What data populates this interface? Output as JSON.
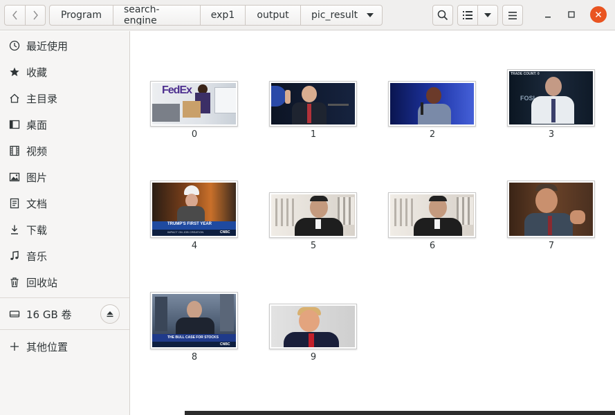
{
  "window": {
    "path": [
      "Program",
      "search-engine",
      "exp1",
      "output",
      "pic_result"
    ]
  },
  "sidebar": {
    "items": [
      {
        "label": "最近使用",
        "icon": "clock-icon"
      },
      {
        "label": "收藏",
        "icon": "star-icon"
      },
      {
        "label": "主目录",
        "icon": "home-icon"
      },
      {
        "label": "桌面",
        "icon": "desktop-icon"
      },
      {
        "label": "视频",
        "icon": "film-icon"
      },
      {
        "label": "图片",
        "icon": "picture-icon"
      },
      {
        "label": "文档",
        "icon": "document-icon"
      },
      {
        "label": "下载",
        "icon": "download-icon"
      },
      {
        "label": "音乐",
        "icon": "music-icon"
      },
      {
        "label": "回收站",
        "icon": "trash-icon"
      }
    ],
    "volume": {
      "label": "16 GB 卷",
      "icon": "drive-icon"
    },
    "other": {
      "label": "其他位置",
      "icon": "plus-icon"
    }
  },
  "files": [
    {
      "name": "0",
      "colors": [
        "#e9ecef",
        "#4d2f8f",
        "#c86b2a"
      ]
    },
    {
      "name": "1",
      "colors": [
        "#0f1a2b",
        "#1e3a7a",
        "#e2b89a"
      ]
    },
    {
      "name": "2",
      "colors": [
        "#0a1a5e",
        "#2a3fb0",
        "#6b3a2a"
      ]
    },
    {
      "name": "3",
      "colors": [
        "#0d1b2a",
        "#27364a",
        "#c49a85"
      ]
    },
    {
      "name": "4",
      "colors": [
        "#3a2a1a",
        "#c56a2a",
        "#1f4aa0"
      ]
    },
    {
      "name": "5",
      "colors": [
        "#e6e2dc",
        "#8a8a8a",
        "#1e1e1e"
      ]
    },
    {
      "name": "6",
      "colors": [
        "#e6e2dc",
        "#8a8a8a",
        "#1e1e1e"
      ]
    },
    {
      "name": "7",
      "colors": [
        "#5a3a26",
        "#b07a55",
        "#3a4a5a"
      ]
    },
    {
      "name": "8",
      "colors": [
        "#5a6a80",
        "#2a3040",
        "#1f3a8a"
      ]
    },
    {
      "name": "9",
      "colors": [
        "#d9d9d9",
        "#1a1f3a",
        "#c8a070"
      ]
    }
  ],
  "thumbnail_text": {
    "0": "FedEx",
    "3": "TRADE COUNT: 0",
    "3b": "FOSL",
    "4": "TRUMP'S FIRST YEAR",
    "4b": "IMPACT ON JOB CREATION",
    "4c": "CNBC",
    "8": "THE BULL CASE FOR STOCKS",
    "8b": "CNBC"
  }
}
